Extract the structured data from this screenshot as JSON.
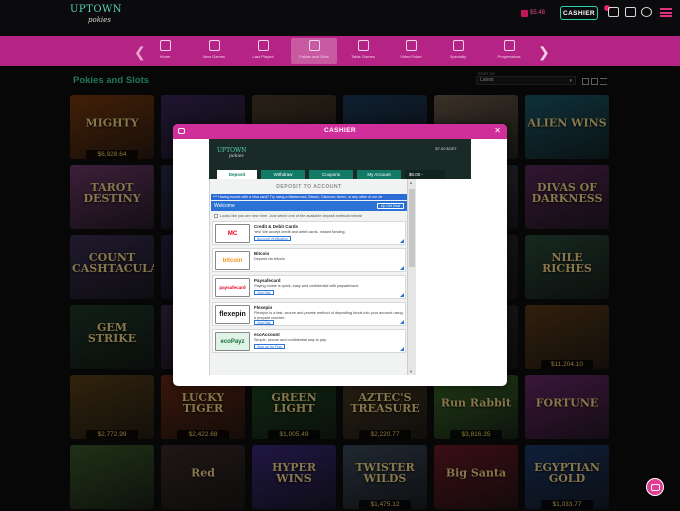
{
  "brand": {
    "logo_top": "UPTOWN",
    "logo_bottom": "pokies"
  },
  "header": {
    "balance": "$5.48",
    "cashier_label": "CASHIER"
  },
  "nav": {
    "items": [
      {
        "label": "Home",
        "active": false
      },
      {
        "label": "New Games",
        "active": false
      },
      {
        "label": "Last Played",
        "active": false
      },
      {
        "label": "Pokies and Slots",
        "active": true
      },
      {
        "label": "Table Games",
        "active": false
      },
      {
        "label": "Video Poker",
        "active": false
      },
      {
        "label": "Specialty",
        "active": false
      },
      {
        "label": "Progressives",
        "active": false
      }
    ]
  },
  "section": {
    "title": "Pokies and Slots",
    "sort_label": "SORT BY",
    "sort_value": "Latest"
  },
  "games": [
    {
      "name": "MIGHTY",
      "jackpot": "$6,928.64",
      "bg": "#7a3a10"
    },
    {
      "name": "",
      "jackpot": "",
      "bg": "#3a2858"
    },
    {
      "name": "",
      "jackpot": "",
      "bg": "#4c3d2a"
    },
    {
      "name": "",
      "jackpot": "",
      "bg": "#1d3a5a"
    },
    {
      "name": "",
      "jackpot": "",
      "bg": "#6a5a4a"
    },
    {
      "name": "ALIEN WINS",
      "jackpot": "",
      "bg": "#1b5a6a"
    },
    {
      "name": "TAROT DESTINY",
      "jackpot": "",
      "bg": "#6e3a6a"
    },
    {
      "name": "",
      "jackpot": "",
      "bg": "#2b2b4a"
    },
    {
      "name": "",
      "jackpot": "",
      "bg": "#22344a"
    },
    {
      "name": "",
      "jackpot": "",
      "bg": "#2e2e3a"
    },
    {
      "name": "",
      "jackpot": "",
      "bg": "#3a3a4a"
    },
    {
      "name": "DIVAS OF DARKNESS",
      "jackpot": "",
      "bg": "#5a2a5a"
    },
    {
      "name": "COUNT CASHTACULAR",
      "jackpot": "",
      "bg": "#3b2f54"
    },
    {
      "name": "",
      "jackpot": "",
      "bg": "#2a2040"
    },
    {
      "name": "",
      "jackpot": "",
      "bg": "#2a2a2a"
    },
    {
      "name": "",
      "jackpot": "",
      "bg": "#2a2a2a"
    },
    {
      "name": "",
      "jackpot": "",
      "bg": "#2a2a2a"
    },
    {
      "name": "NILE RICHES",
      "jackpot": "",
      "bg": "#2a4a3a"
    },
    {
      "name": "GEM STRIKE",
      "jackpot": "",
      "bg": "#1f3a2a"
    },
    {
      "name": "",
      "jackpot": "",
      "bg": "#3a2a4a"
    },
    {
      "name": "",
      "jackpot": "",
      "bg": "#2a2a2a"
    },
    {
      "name": "",
      "jackpot": "",
      "bg": "#2a2a2a"
    },
    {
      "name": "",
      "jackpot": "",
      "bg": "#2a2a2a"
    },
    {
      "name": "",
      "jackpot": "$11,204.10",
      "bg": "#5a3a18"
    },
    {
      "name": "",
      "jackpot": "$2,772.99",
      "bg": "#5a4018"
    },
    {
      "name": "LUCKY TIGER",
      "jackpot": "$2,422.68",
      "bg": "#6a2a14"
    },
    {
      "name": "GREEN LIGHT",
      "jackpot": "$1,005.49",
      "bg": "#1e4a22"
    },
    {
      "name": "AZTEC'S TREASURE",
      "jackpot": "$2,220.77",
      "bg": "#4a3a24"
    },
    {
      "name": "Run Rabbit",
      "jackpot": "$3,816.35",
      "bg": "#3a6a2a"
    },
    {
      "name": "FORTUNE",
      "jackpot": "",
      "bg": "#6a2a6a"
    },
    {
      "name": "",
      "jackpot": "",
      "bg": "#3a5a2a"
    },
    {
      "name": "Red",
      "jackpot": "",
      "bg": "#3a2a2a"
    },
    {
      "name": "HYPER WINS",
      "jackpot": "",
      "bg": "#3a2a7a"
    },
    {
      "name": "TWISTER WILDS",
      "jackpot": "$1,475.12",
      "bg": "#3a4a5a"
    },
    {
      "name": "Big Santa",
      "jackpot": "",
      "bg": "#6a1a24"
    },
    {
      "name": "EGYPTIAN GOLD",
      "jackpot": "$1,033.77",
      "bg": "#1e3a6a"
    }
  ],
  "modal": {
    "title": "CASHIER",
    "logo_top": "UPTOWN",
    "logo_bottom": "pokies",
    "balance": "$7.00 $GET",
    "tabs": [
      "Deposit",
      "Withdraw",
      "Coupons",
      "My Account"
    ],
    "amount": "$0.00 -",
    "deposit_title": "DEPOSIT TO ACCOUNT",
    "notice": "*** Having issues with a Visa card? Try using a Mastercard, Bitcoin, Discover, Amex, or any other of our de",
    "welcome": "Welcome",
    "welcome_btn": "Up Get Deal",
    "new_hint": "Looks like you are new here. Just select one of the available deposit methods below!",
    "methods": [
      {
        "name": "Credit & Debit Cards",
        "desc": "Yes! We accept credit and debit cards. Instant funding.",
        "link": "Account Verification",
        "logo": "MC"
      },
      {
        "name": "Bitcoin",
        "desc": "Deposit via bitcoin",
        "link": "",
        "logo": "bitcoin"
      },
      {
        "name": "Paysafecard",
        "desc": "Paying online is quick, easy and confidential with paysafecard.",
        "link": "Visit Site",
        "logo": "paysafecard"
      },
      {
        "name": "Flexepin",
        "desc": "Flexepin is a fast, secure and private method of depositing funds into your account using a prepaid voucher.",
        "link": "Visit Site",
        "logo": "flexepin"
      },
      {
        "name": "ecoAccount",
        "desc": "Simple, secure and confidential way to pay.",
        "link": "Sign up for Free",
        "logo": "ecoPayz"
      }
    ]
  }
}
